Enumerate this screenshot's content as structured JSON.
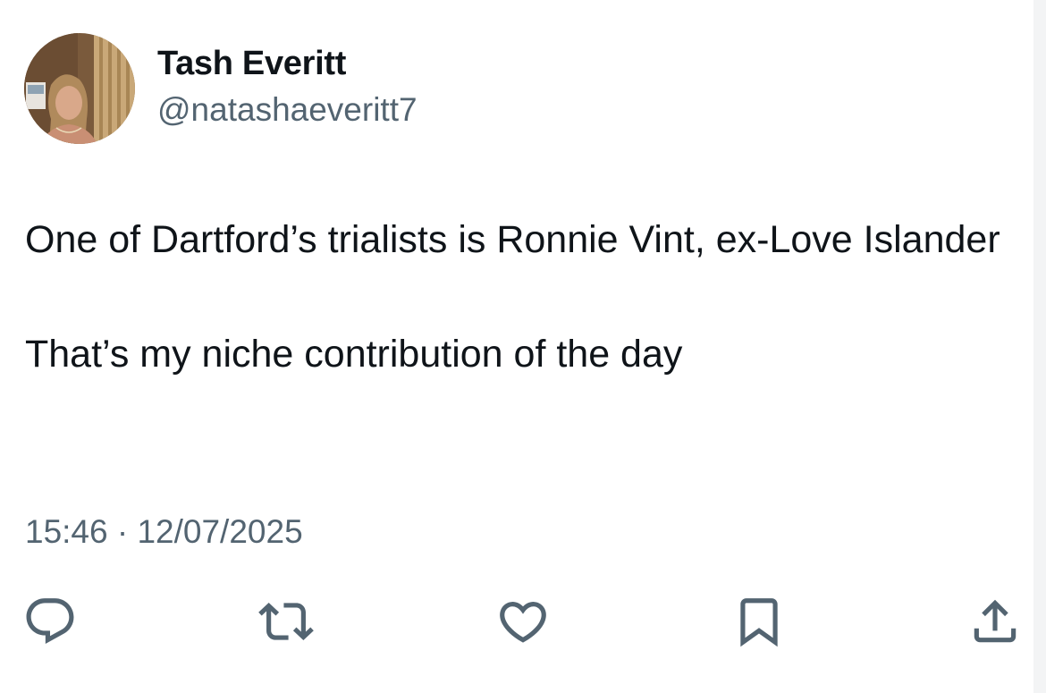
{
  "author": {
    "display_name": "Tash Everitt",
    "handle": "@natashaeveritt7"
  },
  "tweet": {
    "paragraphs": [
      "One of Dartford’s trialists is Ronnie Vint, ex-Love Islander",
      "That’s my niche contribution of the day"
    ],
    "timestamp": "15:46 · 12/07/2025"
  },
  "actions": [
    {
      "name": "reply",
      "icon": "reply-icon"
    },
    {
      "name": "retweet",
      "icon": "retweet-icon"
    },
    {
      "name": "like",
      "icon": "heart-icon"
    },
    {
      "name": "bookmark",
      "icon": "bookmark-icon"
    },
    {
      "name": "share",
      "icon": "share-icon"
    }
  ],
  "colors": {
    "text_primary": "#0f1419",
    "text_secondary": "#536471",
    "icon": "#536471",
    "background": "#ffffff"
  }
}
